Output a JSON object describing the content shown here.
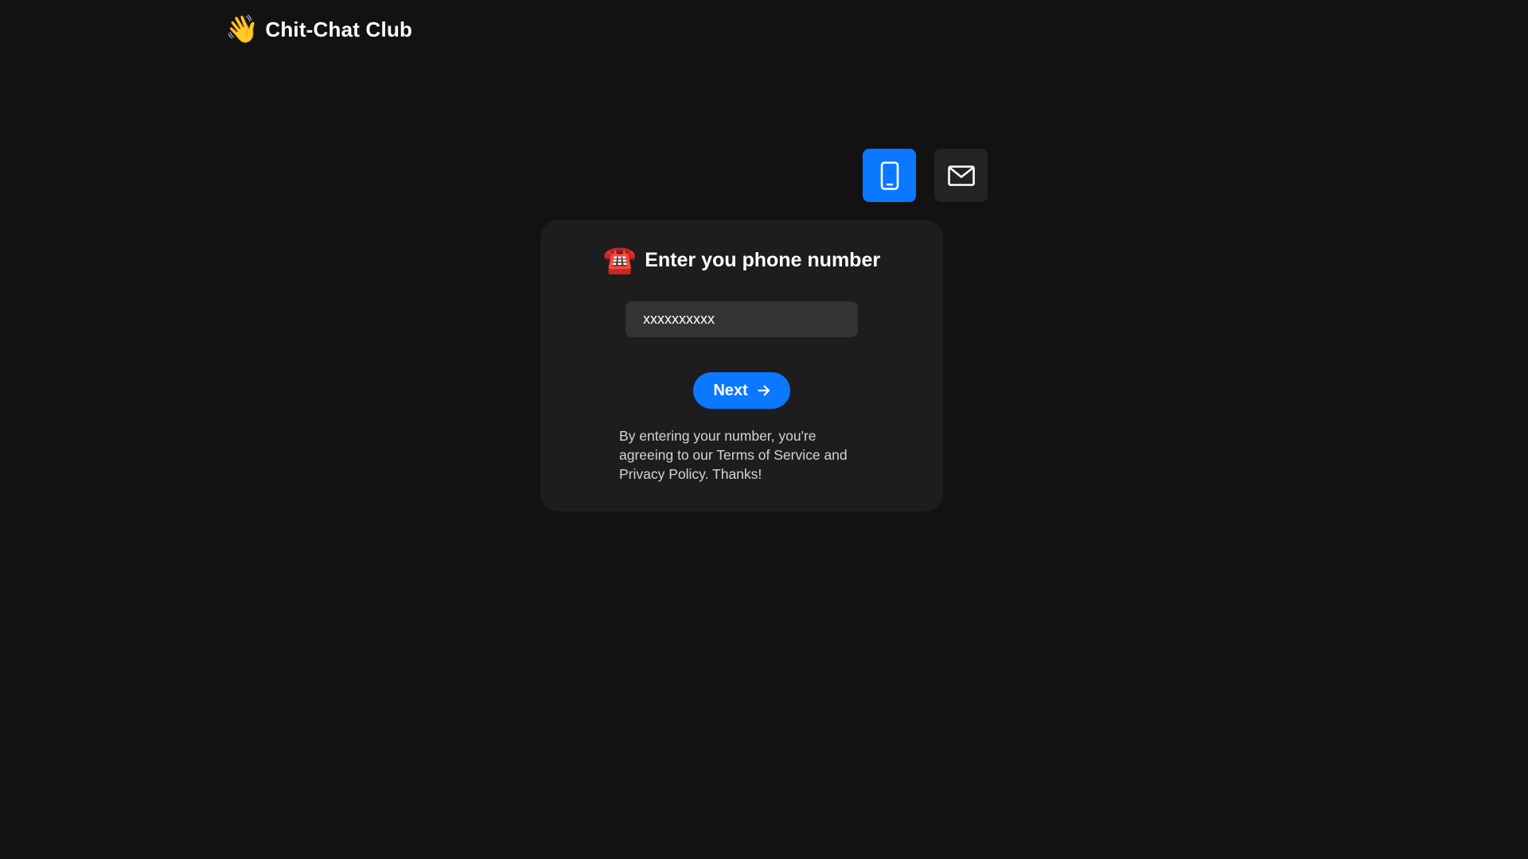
{
  "header": {
    "brand_icon": "waving-hand-icon",
    "brand_emoji": "👋",
    "title": "Chit-Chat Club"
  },
  "mode_switch": {
    "phone_icon": "smartphone-icon",
    "email_icon": "mail-icon",
    "active": "phone"
  },
  "card": {
    "title_icon": "telephone-icon",
    "title_emoji": "☎️",
    "title": "Enter you phone number",
    "input": {
      "placeholder": "xxxxxxxxxx",
      "value": ""
    },
    "next_label": "Next",
    "next_icon": "arrow-right-icon",
    "legal_text": "By entering your number, you're agreeing to our Terms of Service and Privacy Policy. Thanks!"
  },
  "colors": {
    "background": "#121212",
    "card": "#1d1d1d",
    "accent": "#0a78ff",
    "input_bg": "#333333",
    "inactive_button": "#232323"
  }
}
